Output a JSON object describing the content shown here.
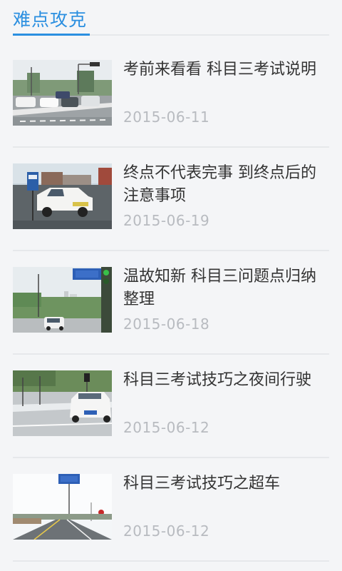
{
  "header": {
    "title": "难点攻克"
  },
  "articles": [
    {
      "title": "考前来看看 科目三考试说明",
      "date": "2015-06-11",
      "image": "exam-road-photo"
    },
    {
      "title": "终点不代表完事 到终点后的注意事项",
      "date": "2015-06-19",
      "image": "white-car-photo"
    },
    {
      "title": "温故知新 科目三问题点归纳整理",
      "date": "2015-06-18",
      "image": "road-sign-photo"
    },
    {
      "title": "科目三考试技巧之夜间行驶",
      "date": "2015-06-12",
      "image": "intersection-photo"
    },
    {
      "title": "科目三考试技巧之超车",
      "date": "2015-06-12",
      "image": "highway-photo"
    }
  ],
  "colors": {
    "accent": "#2b8fe0",
    "title_text": "#333333",
    "date_text": "#b8bbc0",
    "background": "#f4f5f7"
  }
}
